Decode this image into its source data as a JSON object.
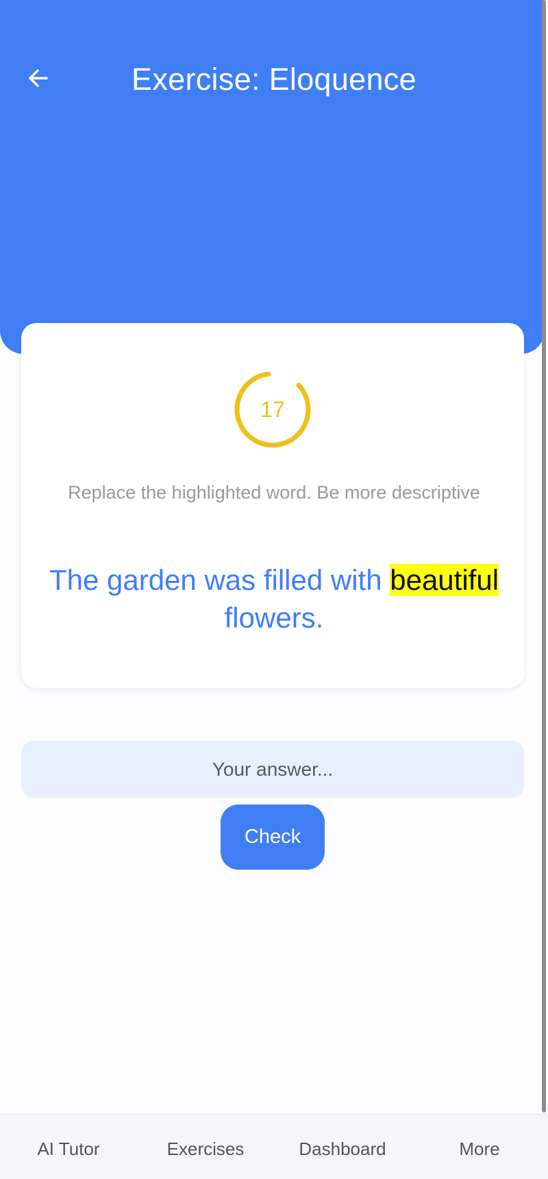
{
  "header": {
    "title": "Exercise: Eloquence",
    "back_icon": "arrow-left-icon",
    "background_color": "#3f7ef5"
  },
  "card": {
    "timer": {
      "seconds_remaining": "17",
      "ring_color": "#f0bf1a",
      "ring_progress_fraction": 0.85
    },
    "instruction": "Replace the highlighted word. Be more descriptive",
    "sentence": {
      "before": "The garden was filled with ",
      "highlighted_word": "beautiful",
      "after": " flowers.",
      "text_color": "#3f7ef5",
      "highlight_color": "#ffff16"
    }
  },
  "answer": {
    "value": "",
    "placeholder": "Your answer..."
  },
  "check_button": {
    "label": "Check"
  },
  "tabs": [
    {
      "label": "AI Tutor"
    },
    {
      "label": "Exercises"
    },
    {
      "label": "Dashboard"
    },
    {
      "label": "More"
    }
  ]
}
